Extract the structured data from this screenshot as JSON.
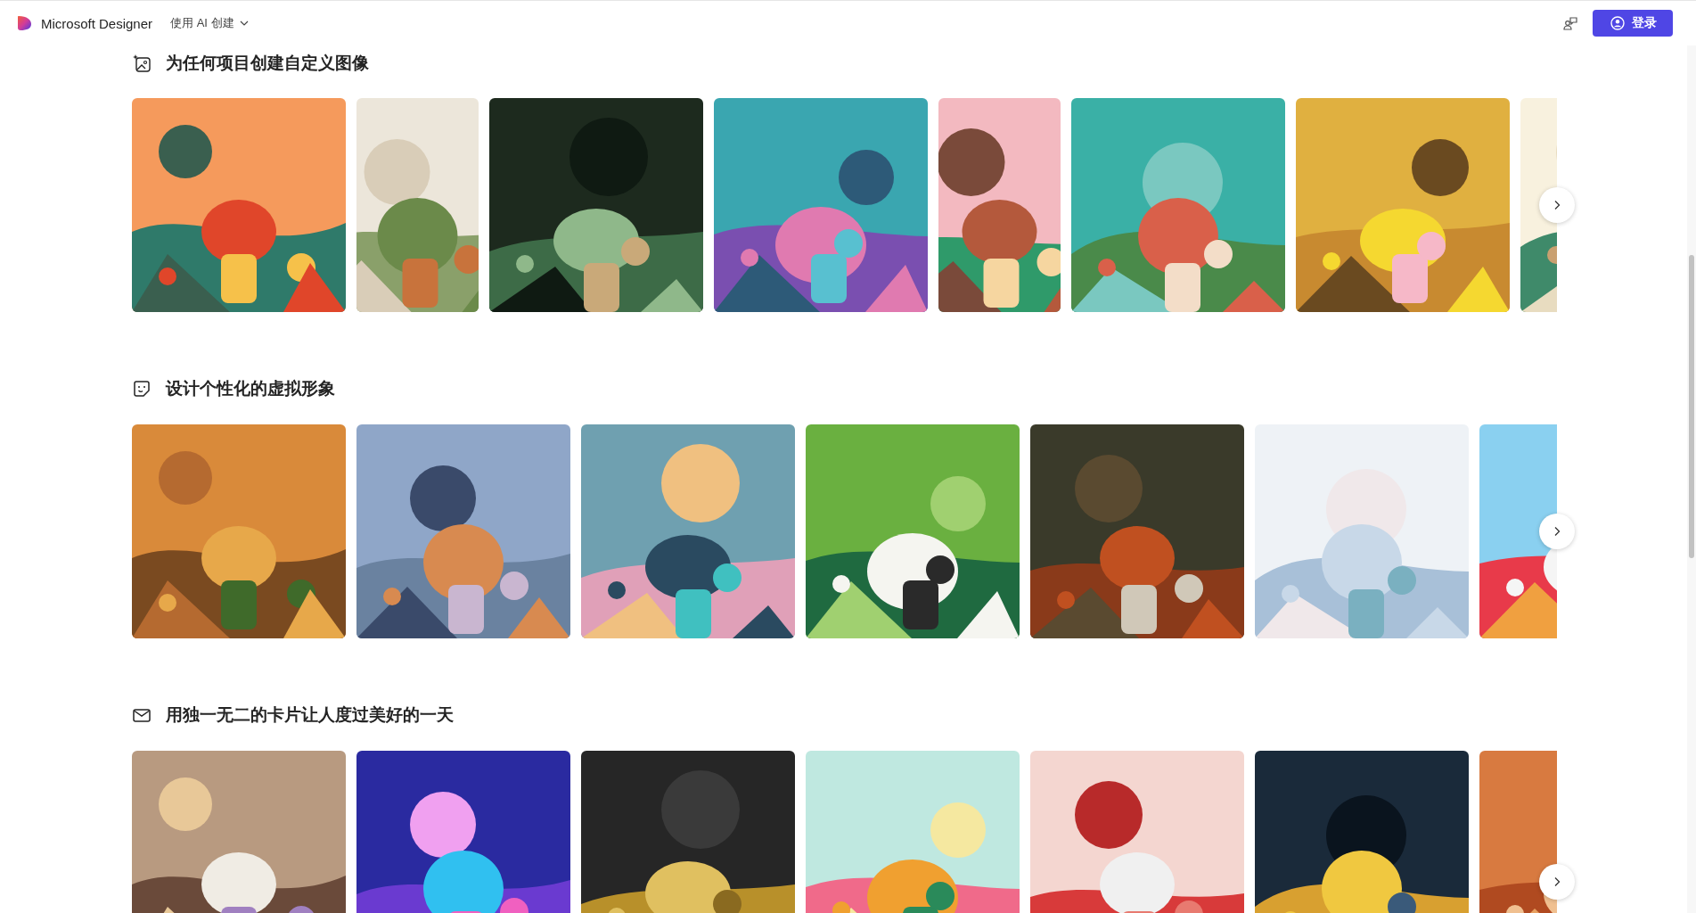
{
  "header": {
    "brand": "Microsoft Designer",
    "create_menu": "使用 AI 创建",
    "login_button": "登录"
  },
  "sections": [
    {
      "title": "为任何项目创建自定义图像"
    },
    {
      "title": "设计个性化的虚拟形象"
    },
    {
      "title": "用独一无二的卡片让人度过美好的一天"
    }
  ]
}
